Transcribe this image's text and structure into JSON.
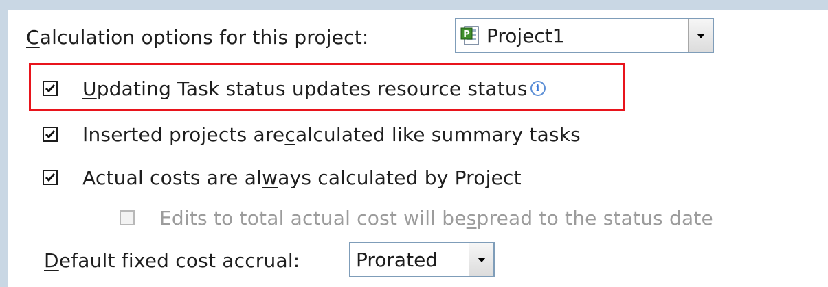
{
  "calc_options": {
    "label_pre": "",
    "label_ul": "C",
    "label_post": "alculation options for this project:",
    "project_select": {
      "value": "Project1",
      "icon": "project-file-icon"
    }
  },
  "options": [
    {
      "pre": "",
      "ul": "U",
      "post": "pdating Task status updates resource status",
      "checked": true,
      "disabled": false,
      "info_icon": true,
      "info_glyph": "i"
    },
    {
      "pre": "Inserted projects are ",
      "ul": "c",
      "post": "alculated like summary tasks",
      "checked": true,
      "disabled": false
    },
    {
      "pre": "Actual costs are al",
      "ul": "w",
      "post": "ays calculated by Project",
      "checked": true,
      "disabled": false
    },
    {
      "pre": "Edits to total actual cost will be ",
      "ul": "s",
      "post": "pread to the status date",
      "checked": false,
      "disabled": true
    }
  ],
  "accrual": {
    "label_ul": "D",
    "label_post": "efault fixed cost accrual:",
    "select": {
      "value": "Prorated"
    }
  },
  "colors": {
    "highlight": "#e8141c",
    "background": "#c9d7e4",
    "info": "#3b79d8"
  }
}
